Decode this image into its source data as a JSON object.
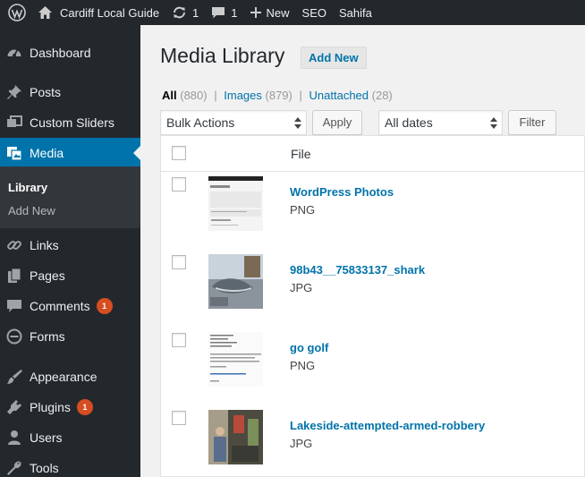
{
  "adminbar": {
    "wp_icon": "wordpress-logo-icon",
    "site_name": "Cardiff Local Guide",
    "updates_count": "1",
    "comments_count": "1",
    "new_label": "New",
    "seo_label": "SEO",
    "theme_label": "Sahifa"
  },
  "sidebar": {
    "items": [
      {
        "label": "Dashboard",
        "icon": "dashboard-icon"
      },
      {
        "label": "Posts",
        "icon": "pushpin-icon"
      },
      {
        "label": "Custom Sliders",
        "icon": "slides-icon"
      },
      {
        "label": "Media",
        "icon": "media-icon"
      },
      {
        "label": "Links",
        "icon": "link-icon"
      },
      {
        "label": "Pages",
        "icon": "pages-icon"
      },
      {
        "label": "Comments",
        "icon": "comment-icon",
        "badge": "1"
      },
      {
        "label": "Forms",
        "icon": "forms-icon"
      },
      {
        "label": "Appearance",
        "icon": "paintbrush-icon"
      },
      {
        "label": "Plugins",
        "icon": "plugin-icon",
        "badge": "1"
      },
      {
        "label": "Users",
        "icon": "users-icon"
      },
      {
        "label": "Tools",
        "icon": "wrench-icon"
      }
    ],
    "submenu": {
      "library": "Library",
      "add_new": "Add New"
    }
  },
  "main": {
    "title": "Media Library",
    "add_new": "Add New",
    "filters": {
      "all": "All",
      "all_count": "(880)",
      "images": "Images",
      "images_count": "(879)",
      "unattached": "Unattached",
      "unattached_count": "(28)",
      "separator": "|"
    },
    "bulk_actions": "Bulk Actions",
    "apply": "Apply",
    "dates": "All dates",
    "filter": "Filter",
    "table": {
      "header_file": "File",
      "rows": [
        {
          "title": "WordPress Photos",
          "type": "PNG"
        },
        {
          "title": "98b43__75833137_shark",
          "type": "JPG"
        },
        {
          "title": "go golf",
          "type": "PNG"
        },
        {
          "title": "Lakeside-attempted-armed-robbery",
          "type": "JPG"
        }
      ]
    }
  },
  "colors": {
    "admin_bar": "#23282d",
    "accent": "#0073aa",
    "badge": "#d54e21",
    "background": "#f1f1f1"
  }
}
